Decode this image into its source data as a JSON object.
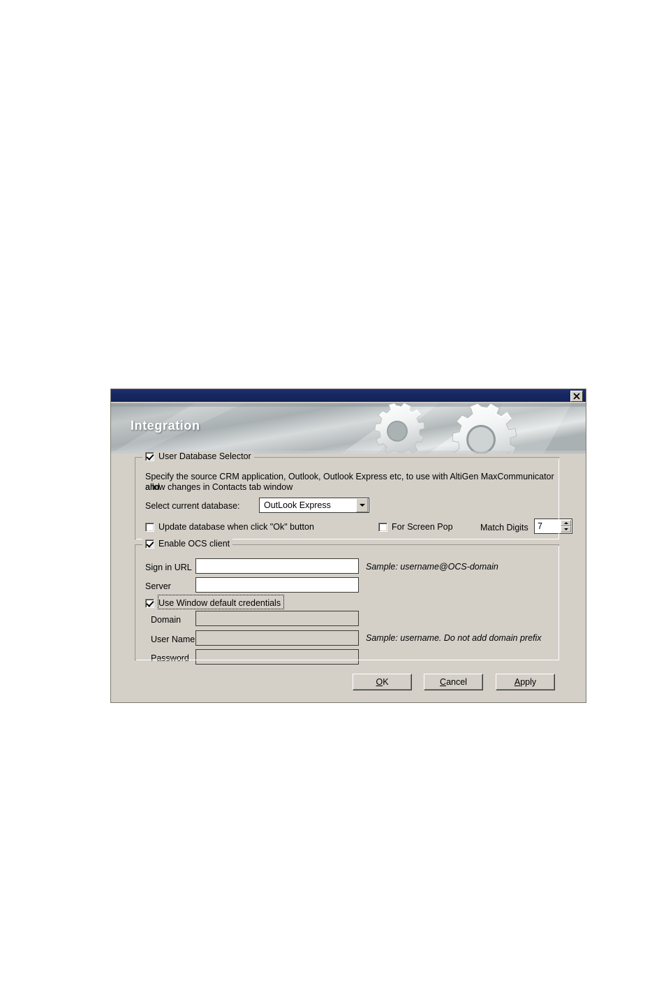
{
  "dialog": {
    "banner_title": "Integration",
    "close_icon": "close-icon"
  },
  "database_group": {
    "legend": "User Database Selector",
    "checked": true,
    "description_line1": "Specify the source CRM application, Outlook, Outlook Express etc, to use with AltiGen MaxCommunicator and",
    "description_line2": "allow changes in Contacts tab window",
    "select_label": "Select current database:",
    "selected_database": "OutLook Express",
    "dropdown_icon": "chevron-down-icon",
    "update_db_label": "Update database when click \"Ok\" button",
    "update_db_checked": false,
    "screen_pop_label": "For Screen Pop",
    "screen_pop_checked": false,
    "match_digits_label": "Match Digits",
    "match_digits_value": "7",
    "spinner_up_icon": "spinner-up-icon",
    "spinner_down_icon": "spinner-down-icon"
  },
  "ocs_group": {
    "legend": "Enable OCS client",
    "checked": true,
    "sign_in_url_label": "Sign in URL",
    "sign_in_url_value": "",
    "sign_in_url_sample": "Sample: username@OCS-domain",
    "server_label": "Server",
    "server_value": "",
    "use_default_creds_label": "Use Window default credentials",
    "use_default_creds_checked": true,
    "domain_label": "Domain",
    "domain_value": "",
    "user_name_label": "User Name",
    "user_name_value": "",
    "user_name_sample": "Sample: username. Do not add domain prefix",
    "password_label": "Password",
    "password_value": ""
  },
  "footer": {
    "ok_label_pre": "",
    "ok_label_accel": "O",
    "ok_label_post": "K",
    "cancel_label_pre": "",
    "cancel_label_accel": "C",
    "cancel_label_post": "ancel",
    "apply_label_pre": "",
    "apply_label_accel": "A",
    "apply_label_post": "pply"
  },
  "colors": {
    "titlebar": "#16275e",
    "dialog_face": "#d4d0c8",
    "field_border": "#3a3a36"
  }
}
